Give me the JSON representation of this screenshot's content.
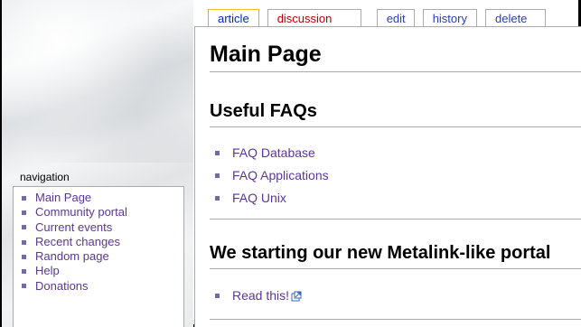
{
  "tabs": [
    {
      "label": "article",
      "selected": true
    },
    {
      "label": "discussion",
      "selected": false,
      "new": true
    },
    {
      "label": "edit",
      "selected": false
    },
    {
      "label": "history",
      "selected": false
    },
    {
      "label": "delete",
      "selected": false
    }
  ],
  "navigation": {
    "heading": "navigation",
    "items": [
      "Main Page",
      "Community portal",
      "Current events",
      "Recent changes",
      "Random page",
      "Help",
      "Donations"
    ]
  },
  "content": {
    "title": "Main Page",
    "sections": [
      {
        "heading": "Useful FAQs",
        "links": [
          "FAQ Database",
          "FAQ Applications",
          "FAQ Unix"
        ]
      },
      {
        "heading": "We starting our new Metalink-like portal",
        "links": [
          "Read this!"
        ]
      }
    ]
  },
  "colors": {
    "link": "#5a3696",
    "tab_link": "#2a3fb0",
    "new_link": "#ba0000",
    "selected_tab_border": "#fabd23",
    "border": "#aaaaaa",
    "bullet": "#6e6e9e"
  },
  "icons": {
    "external_link": "external-link-icon",
    "bullet": "square-bullet-icon"
  }
}
